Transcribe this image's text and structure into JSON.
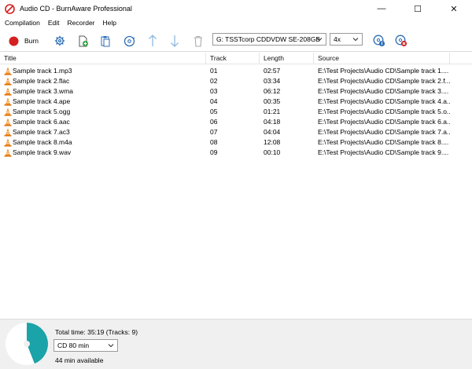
{
  "window": {
    "title": "Audio CD - BurnAware Professional",
    "controls": {
      "minimize": "—",
      "maximize": "☐",
      "close": "✕"
    }
  },
  "menu": [
    "Compilation",
    "Edit",
    "Recorder",
    "Help"
  ],
  "toolbar": {
    "burn_label": "Burn",
    "drive": "G: TSSTcorp CDDVDW SE-208GB",
    "speed": "4x",
    "icons": [
      "burn-icon",
      "settings-icon",
      "add-icon",
      "paste-icon",
      "disc-info-icon",
      "move-up-icon",
      "move-down-icon",
      "delete-icon",
      "drive-info-icon",
      "erase-icon"
    ]
  },
  "columns": {
    "title": "Title",
    "track": "Track",
    "length": "Length",
    "source": "Source"
  },
  "tracks": [
    {
      "title": "Sample track 1.mp3",
      "track": "01",
      "length": "02:57",
      "source": "E:\\Test Projects\\Audio CD\\Sample track 1...."
    },
    {
      "title": "Sample track 2.flac",
      "track": "02",
      "length": "03:34",
      "source": "E:\\Test Projects\\Audio CD\\Sample track 2.f..."
    },
    {
      "title": "Sample track 3.wma",
      "track": "03",
      "length": "06:12",
      "source": "E:\\Test Projects\\Audio CD\\Sample track 3...."
    },
    {
      "title": "Sample track 4.ape",
      "track": "04",
      "length": "00:35",
      "source": "E:\\Test Projects\\Audio CD\\Sample track 4.a..."
    },
    {
      "title": "Sample track 5.ogg",
      "track": "05",
      "length": "01:21",
      "source": "E:\\Test Projects\\Audio CD\\Sample track 5.o..."
    },
    {
      "title": "Sample track 6.aac",
      "track": "06",
      "length": "04:18",
      "source": "E:\\Test Projects\\Audio CD\\Sample track 6.a..."
    },
    {
      "title": "Sample track 7.ac3",
      "track": "07",
      "length": "04:04",
      "source": "E:\\Test Projects\\Audio CD\\Sample track 7.a..."
    },
    {
      "title": "Sample track 8.m4a",
      "track": "08",
      "length": "12:08",
      "source": "E:\\Test Projects\\Audio CD\\Sample track 8...."
    },
    {
      "title": "Sample track 9.wav",
      "track": "09",
      "length": "00:10",
      "source": "E:\\Test Projects\\Audio CD\\Sample track 9...."
    }
  ],
  "status": {
    "total_time": "Total time: 35:19 (Tracks: 9)",
    "disc_type": "CD 80 min",
    "available": "44 min available",
    "used_fraction": 0.44
  },
  "colors": {
    "accent": "#1aa3a8",
    "burn_red": "#d42020",
    "cone_orange": "#f08a1c"
  }
}
